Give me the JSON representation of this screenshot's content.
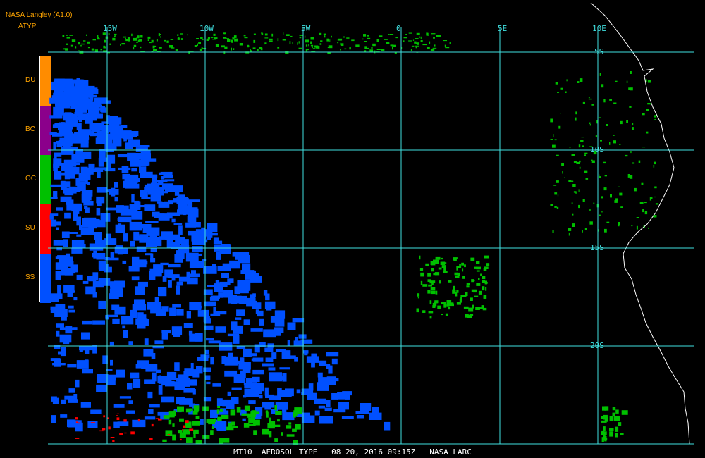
{
  "header": {
    "title": "NASA Langley (A1.0)",
    "parameter": "ATYP"
  },
  "legend": {
    "items": [
      {
        "code": "DU",
        "color": "#ff8c00"
      },
      {
        "code": "BC",
        "color": "#8b008b"
      },
      {
        "code": "OC",
        "color": "#00c000"
      },
      {
        "code": "SU",
        "color": "#ff0000"
      },
      {
        "code": "SS",
        "color": "#0050ff"
      }
    ]
  },
  "grid": {
    "lon_labels": [
      "15W",
      "10W",
      "5W",
      "0",
      "5E",
      "10E"
    ],
    "lat_labels": [
      "5S",
      "10S",
      "15S",
      "20S"
    ],
    "line_color": "#40e0e0"
  },
  "footer": {
    "text": "MT10  AEROSOL TYPE   08 20, 2016 09:15Z   NASA LARC"
  }
}
